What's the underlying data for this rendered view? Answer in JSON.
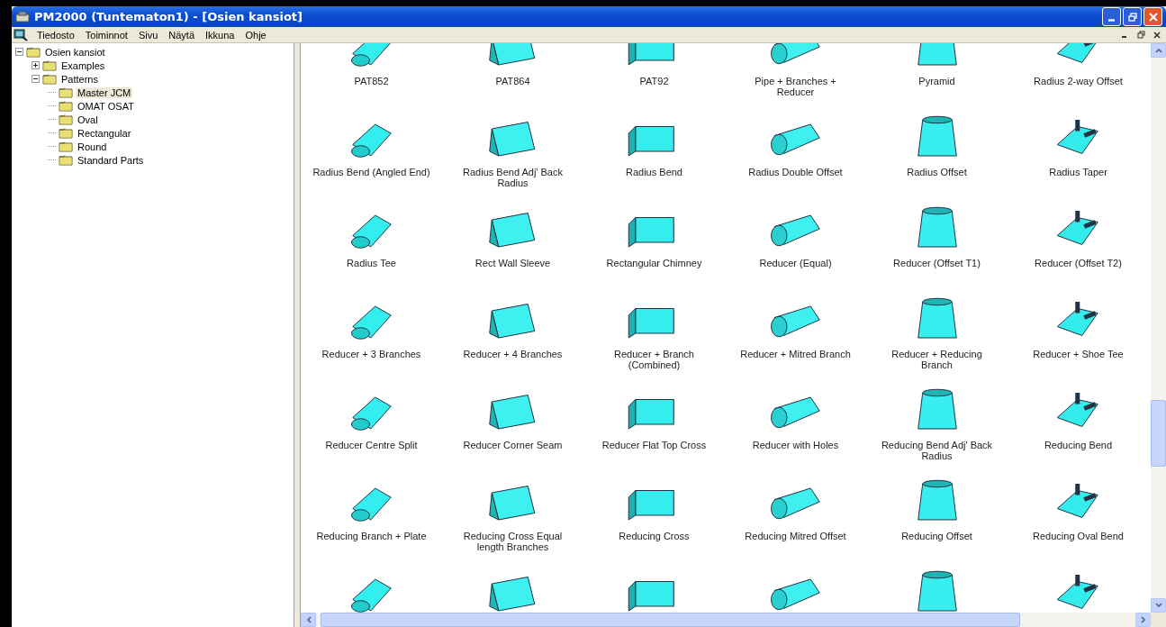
{
  "window": {
    "title": "PM2000 (Tuntematon1) - [Osien kansiot]"
  },
  "menu": [
    "Tiedosto",
    "Toiminnot",
    "Sivu",
    "Näytä",
    "Ikkuna",
    "Ohje"
  ],
  "tree": [
    {
      "label": "Osien kansiot",
      "expanded": true,
      "selected": false,
      "children": [
        {
          "label": "Examples",
          "expanded": false,
          "selected": false
        },
        {
          "label": "Patterns",
          "expanded": true,
          "selected": false,
          "children": [
            {
              "label": "Master JCM",
              "selected": true
            },
            {
              "label": "OMAT OSAT",
              "selected": false
            },
            {
              "label": "Oval",
              "selected": false
            },
            {
              "label": "Rectangular",
              "selected": false
            },
            {
              "label": "Round",
              "selected": false
            },
            {
              "label": "Standard Parts",
              "selected": false
            }
          ]
        }
      ]
    }
  ],
  "items": [
    {
      "kind": "part",
      "label": "PAT852"
    },
    {
      "kind": "part",
      "label": "PAT864"
    },
    {
      "kind": "part",
      "label": "PAT92"
    },
    {
      "kind": "part",
      "label": "Pipe + Branches + Reducer"
    },
    {
      "kind": "part",
      "label": "Pyramid"
    },
    {
      "kind": "part",
      "label": "Radius 2-way Offset"
    },
    {
      "kind": "part",
      "label": "Radius Bend (Angled End)"
    },
    {
      "kind": "part",
      "label": "Radius Bend Adj' Back Radius"
    },
    {
      "kind": "part",
      "label": "Radius Bend"
    },
    {
      "kind": "part",
      "label": "Radius Double Offset"
    },
    {
      "kind": "part",
      "label": "Radius Offset"
    },
    {
      "kind": "part",
      "label": "Radius Taper"
    },
    {
      "kind": "part",
      "label": "Radius Tee"
    },
    {
      "kind": "part",
      "label": "Rect Wall Sleeve"
    },
    {
      "kind": "part",
      "label": "Rectangular Chimney"
    },
    {
      "kind": "part",
      "label": "Reducer (Equal)"
    },
    {
      "kind": "part",
      "label": "Reducer (Offset T1)"
    },
    {
      "kind": "part",
      "label": "Reducer (Offset T2)"
    },
    {
      "kind": "part",
      "label": "Reducer + 3 Branches"
    },
    {
      "kind": "part",
      "label": "Reducer + 4 Branches"
    },
    {
      "kind": "part",
      "label": "Reducer + Branch (Combined)"
    },
    {
      "kind": "part",
      "label": "Reducer + Mitred Branch"
    },
    {
      "kind": "part",
      "label": "Reducer + Reducing Branch"
    },
    {
      "kind": "part",
      "label": "Reducer + Shoe Tee"
    },
    {
      "kind": "part",
      "label": "Reducer Centre Split"
    },
    {
      "kind": "part",
      "label": "Reducer Corner Seam"
    },
    {
      "kind": "part",
      "label": "Reducer Flat Top Cross"
    },
    {
      "kind": "part",
      "label": "Reducer with Holes"
    },
    {
      "kind": "part",
      "label": "Reducing Bend Adj' Back Radius"
    },
    {
      "kind": "part",
      "label": "Reducing Bend"
    },
    {
      "kind": "part",
      "label": "Reducing Branch + Plate"
    },
    {
      "kind": "part",
      "label": "Reducing Cross Equal length Branches"
    },
    {
      "kind": "part",
      "label": "Reducing Cross"
    },
    {
      "kind": "part",
      "label": "Reducing Mitred Offset"
    },
    {
      "kind": "part",
      "label": "Reducing Offset"
    },
    {
      "kind": "part",
      "label": "Reducing Oval Bend"
    },
    {
      "kind": "clipped"
    },
    {
      "kind": "clipped"
    },
    {
      "kind": "clipped"
    },
    {
      "kind": "clipped"
    },
    {
      "kind": "clipped"
    },
    {
      "kind": "clipped"
    }
  ]
}
